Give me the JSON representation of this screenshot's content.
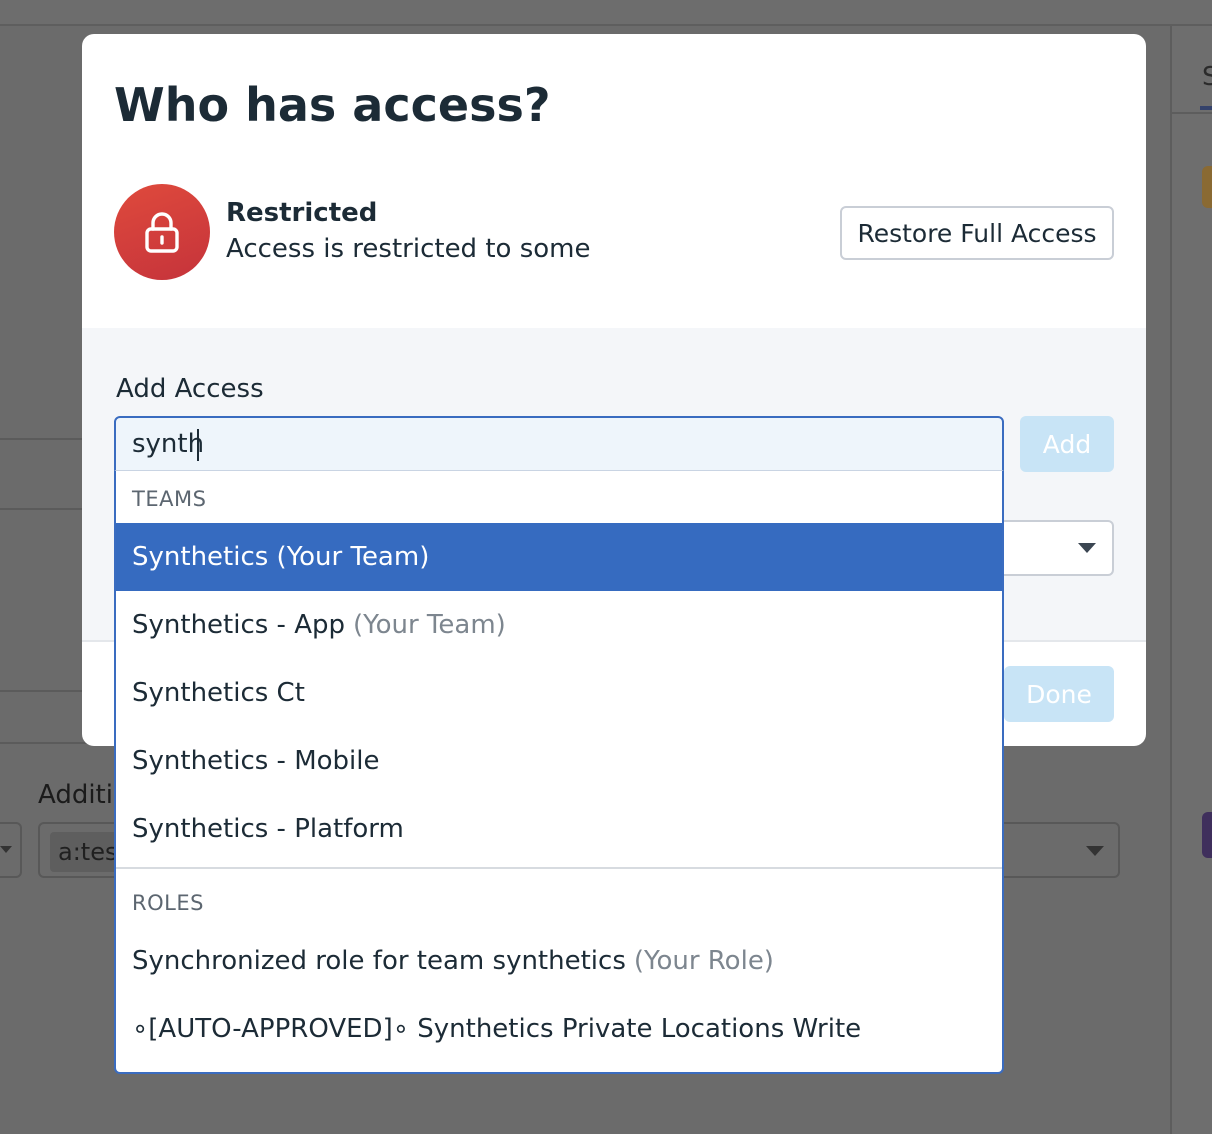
{
  "background": {
    "tab_partial": "S",
    "additional_label_partial": "Additi",
    "select_tag_partial": "a:tes"
  },
  "modal": {
    "title": "Who has access?",
    "status": {
      "icon": "lock-icon",
      "title": "Restricted",
      "description": "Access is restricted to some"
    },
    "restore_button": "Restore Full Access",
    "add_access_label": "Add Access",
    "search": {
      "value": "synth",
      "placeholder": ""
    },
    "add_button": "Add",
    "done_button": "Done"
  },
  "dropdown": {
    "groups": [
      {
        "header": "TEAMS",
        "options": [
          {
            "label": "Synthetics (Your Team)",
            "suffix": "",
            "selected": true
          },
          {
            "label": "Synthetics - App",
            "suffix": "(Your Team)",
            "selected": false
          },
          {
            "label": "Synthetics Ct",
            "suffix": "",
            "selected": false
          },
          {
            "label": "Synthetics - Mobile",
            "suffix": "",
            "selected": false
          },
          {
            "label": "Synthetics - Platform",
            "suffix": "",
            "selected": false
          }
        ]
      },
      {
        "header": "ROLES",
        "options": [
          {
            "label": "Synchronized role for team synthetics",
            "suffix": "(Your Role)",
            "selected": false
          },
          {
            "label": "∘[AUTO-APPROVED]∘ Synthetics Private Locations Write",
            "suffix": "",
            "selected": false
          }
        ]
      }
    ]
  },
  "colors": {
    "accent": "#366bc0",
    "danger": "#d9413b",
    "disabled_button": "#c8e4f6"
  }
}
